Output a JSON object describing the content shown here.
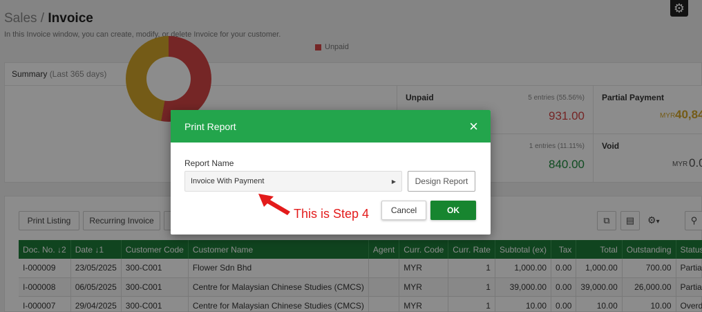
{
  "header": {
    "breadcrumb_parent": "Sales",
    "breadcrumb_sep": " / ",
    "breadcrumb_current": "Invoice",
    "subtitle": "In this Invoice window, you can create, modify, or delete Invoice for your customer."
  },
  "summary": {
    "title": "Summary",
    "period": "(Last 365 days)",
    "legend_unpaid": "Unpaid",
    "tiles": {
      "unpaid": {
        "title": "Unpaid",
        "meta": "5 entries (55.56%)",
        "value": "931.00"
      },
      "partial": {
        "title": "Partial Payment",
        "currency": "MYR",
        "value": "40,84"
      },
      "paid": {
        "meta": "1 entries (11.11%)",
        "value": "840.00"
      },
      "void": {
        "title": "Void",
        "currency": "MYR",
        "value": "0.0"
      }
    }
  },
  "toolbar": {
    "print_listing": "Print Listing",
    "recurring_invoice": "Recurring Invoice",
    "gear_caret": "▾"
  },
  "table": {
    "columns": [
      "Doc. No. ↓2",
      "Date ↓1",
      "Customer Code",
      "Customer Name",
      "Agent",
      "Curr. Code",
      "Curr. Rate",
      "Subtotal (ex)",
      "Tax",
      "Total",
      "Outstanding",
      "Status"
    ],
    "rows": [
      [
        "I-000009",
        "23/05/2025",
        "300-C001",
        "Flower Sdn Bhd",
        "",
        "MYR",
        "1",
        "1,000.00",
        "0.00",
        "1,000.00",
        "700.00",
        "Partial P"
      ],
      [
        "I-000008",
        "06/05/2025",
        "300-C001",
        "Centre for Malaysian Chinese Studies (CMCS)",
        "",
        "MYR",
        "1",
        "39,000.00",
        "0.00",
        "39,000.00",
        "26,000.00",
        "Partial P"
      ],
      [
        "I-000007",
        "29/04/2025",
        "300-C001",
        "Centre for Malaysian Chinese Studies (CMCS)",
        "",
        "MYR",
        "1",
        "10.00",
        "0.00",
        "10.00",
        "10.00",
        "Overdue"
      ]
    ]
  },
  "modal": {
    "title": "Print Report",
    "close": "×",
    "report_name_label": "Report Name",
    "report_name_value": "Invoice With Payment",
    "design_report": "Design Report",
    "cancel": "Cancel",
    "ok": "OK"
  },
  "annotation": {
    "text": "This is Step 4"
  },
  "colors": {
    "header_green": "#23a54c",
    "ok_green": "#17852f",
    "table_header_green": "#1e7d3a",
    "annotation_red": "#e31b1b",
    "unpaid_red": "#d64545",
    "partial_gold": "#d4a72a"
  }
}
